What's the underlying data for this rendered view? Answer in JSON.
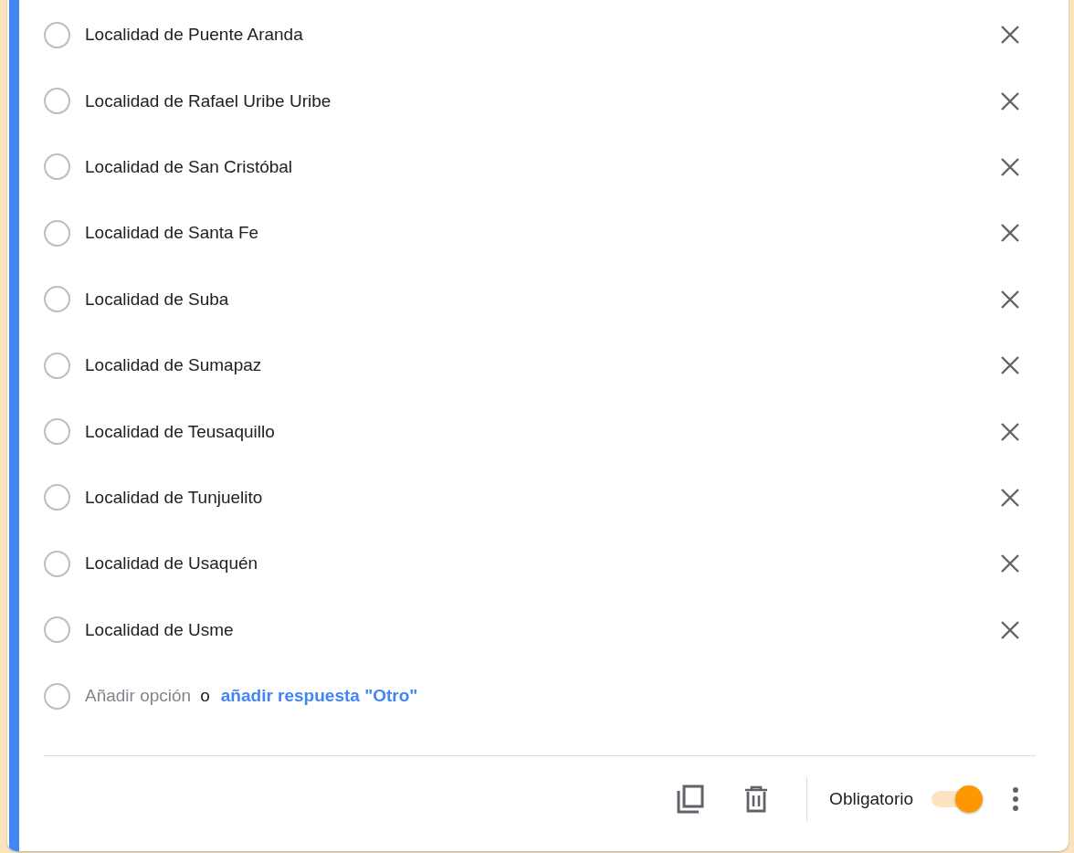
{
  "options": [
    {
      "label": "Localidad de Puente Aranda"
    },
    {
      "label": "Localidad de Rafael Uribe Uribe"
    },
    {
      "label": "Localidad de San Cristóbal"
    },
    {
      "label": "Localidad de Santa Fe"
    },
    {
      "label": "Localidad de Suba"
    },
    {
      "label": "Localidad de Sumapaz"
    },
    {
      "label": "Localidad de Teusaquillo"
    },
    {
      "label": "Localidad de Tunjuelito"
    },
    {
      "label": "Localidad de Usaquén"
    },
    {
      "label": "Localidad de Usme"
    }
  ],
  "add_option": {
    "placeholder": "Añadir opción",
    "separator": "o",
    "link": "añadir respuesta \"Otro\""
  },
  "footer": {
    "required_label": "Obligatorio",
    "required": true
  }
}
